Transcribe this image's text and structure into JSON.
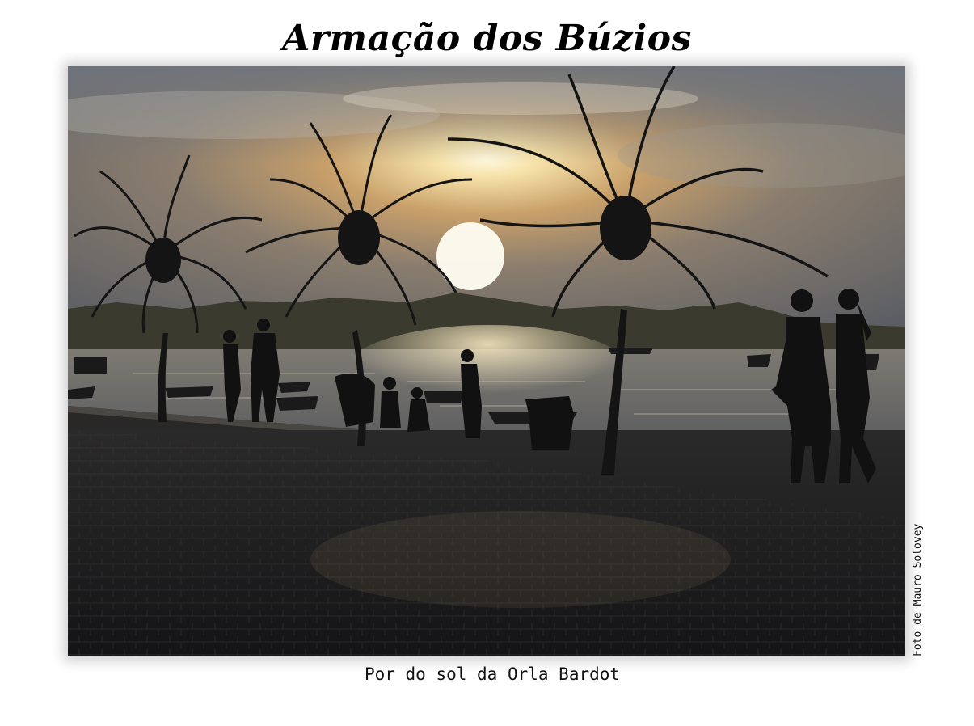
{
  "title": "Armação dos Búzios",
  "caption": "Por do sol da Orla Bardot",
  "credit": "Foto de Mauro Solovey",
  "colors": {
    "sky_glow": "#f4e3b8",
    "sky_top": "#8a8f98",
    "water": "#6d6f74",
    "silhouette": "#141414",
    "pavement": "#1c1c1e"
  }
}
